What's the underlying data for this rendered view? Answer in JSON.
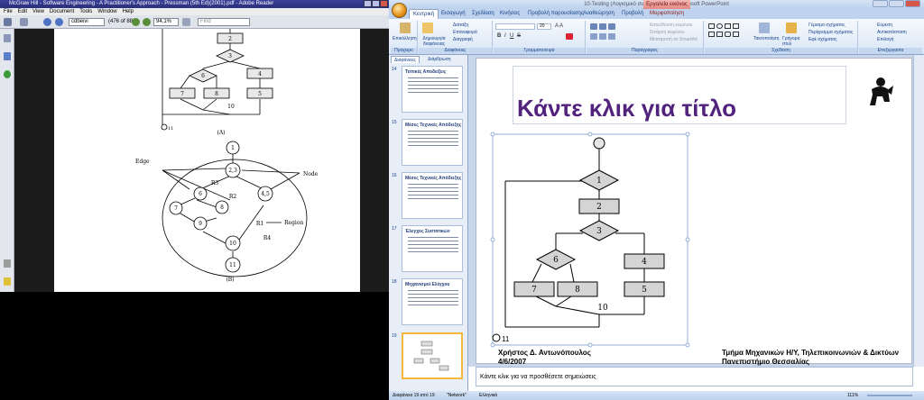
{
  "reader": {
    "title": "McGraw Hill - Software Engineering - A Practitioner's Approach - Pressman (5th Ed)(2001).pdf - Adobe Reader",
    "menu": [
      "File",
      "Edit",
      "View",
      "Document",
      "Tools",
      "Window",
      "Help"
    ],
    "page_field": "cdbeivi",
    "page_count": "(476 of 889)",
    "zoom": "94,1%",
    "find_placeholder": "Find",
    "figure": {
      "nodes_a": [
        "2",
        "3",
        "6",
        "4",
        "7",
        "8",
        "5",
        "10"
      ],
      "start_label": "11",
      "caption_a": "(A)",
      "edge_label": "Edge",
      "node_label": "Node",
      "region_label": "Region",
      "nodes_b": [
        "1",
        "2,3",
        "6",
        "4,5",
        "7",
        "8",
        "9",
        "10",
        "11"
      ],
      "regions": [
        "R1",
        "R2",
        "R3",
        "R4"
      ],
      "caption_b": "(B)"
    }
  },
  "ppt": {
    "title": "10-Testing (Λογισμικό συμβατότητας) - Microsoft PowerPoint",
    "context_tab": "Εργαλεία εικόνας",
    "tabs": [
      "Κεντρική",
      "Εισαγωγή",
      "Σχεδίαση",
      "Κινήσεις",
      "Προβολή παρουσίασης",
      "Αναθεώρηση",
      "Προβολή",
      "Μορφοποίηση"
    ],
    "ribbon": {
      "paste": "Επικόλληση",
      "new_slide": "Δημιουργία διαφάνειας",
      "layout": "Διάταξη",
      "reset": "Επαναφορά",
      "delete": "Διαγραφή",
      "font_size": "20",
      "groups": [
        "Πρόχειρο",
        "Διαφάνειες",
        "Γραμματοσειρά",
        "Παράγραφος",
        "Σχεδίαση",
        "Επεξεργασία"
      ],
      "text_direction": "Κατεύθυνση κειμένου",
      "align_text": "Στοίχιση κειμένου",
      "smartart": "Μετατροπή σε SmartArt",
      "arrange": "Τακτοποίηση",
      "quick_styles": "Γρήγορα στυλ",
      "shape_fill": "Γέμισμα σχήματος",
      "shape_outline": "Περίγραμμα σχήματος",
      "shape_effects": "Εφέ σχήματος",
      "find": "Εύρεση",
      "replace": "Αντικατάσταση",
      "select": "Επιλογή"
    },
    "panel_tabs": [
      "Διαφάνειες",
      "Διάρθρωση"
    ],
    "thumbnails": [
      {
        "num": "14",
        "title": "Τυπικές Αποδείξεις"
      },
      {
        "num": "15",
        "title": "Μέσες Τεχνικές Απόδειξης"
      },
      {
        "num": "16",
        "title": "Μέσες Τεχνικές Απόδειξης"
      },
      {
        "num": "17",
        "title": "Έλεγχος Συστατικών"
      },
      {
        "num": "18",
        "title": "Μηχανισμοί Ελέγχου"
      },
      {
        "num": "19",
        "title": ""
      }
    ],
    "slide": {
      "title": "Κάντε κλικ για τίτλο",
      "nodes": [
        "1",
        "2",
        "3",
        "6",
        "4",
        "7",
        "8",
        "5",
        "10"
      ],
      "start": "11",
      "footer_left_1": "Χρήστος Δ. Αντωνόπουλος",
      "footer_left_2": "4/6/2007",
      "footer_right_1": "Τμήμα Μηχανικών Η/Υ, Τηλεπικοινωνιών & Δικτύων",
      "footer_right_2": "Πανεπιστήμιο Θεσσαλίας"
    },
    "notes": "Κάντε κλικ για να προσθέσετε σημειώσεις",
    "status": {
      "slide": "Διαφάνεια 19 από 19",
      "theme": "\"Network\"",
      "lang": "Ελληνικά",
      "zoom": "111%"
    },
    "colors": {
      "title": "#51237d",
      "accent": "#15428b"
    }
  }
}
